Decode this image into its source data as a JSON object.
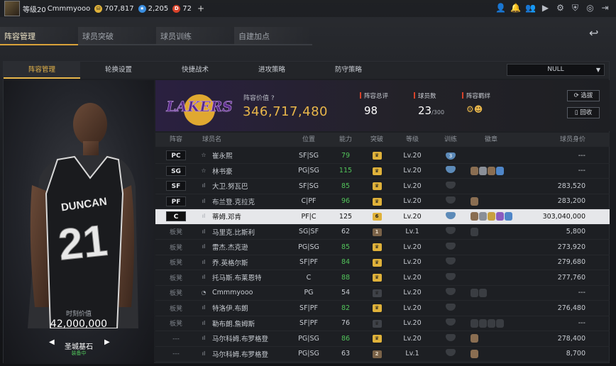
{
  "topbar": {
    "level": "等级20",
    "username": "Cmmmyooo",
    "gold": "707,817",
    "gems": "2,205",
    "tickets": "72",
    "plus": "+"
  },
  "main_tabs": [
    {
      "label": "阵容管理",
      "active": true
    },
    {
      "label": "球员突破",
      "active": false
    },
    {
      "label": "球员训练",
      "active": false
    },
    {
      "label": "自建加点",
      "active": false
    }
  ],
  "sub_tabs": [
    {
      "label": "阵容管理",
      "active": true
    },
    {
      "label": "轮换设置",
      "active": false
    },
    {
      "label": "快捷战术",
      "active": false
    },
    {
      "label": "进攻策略",
      "active": false
    },
    {
      "label": "防守策略",
      "active": false
    }
  ],
  "dropdown": {
    "value": "NULL"
  },
  "player_card": {
    "value_label": "时刻价值",
    "value": "42,000,000",
    "name": "圣城基石",
    "sub": "装备中",
    "jersey_name": "DUNCAN",
    "jersey_number": "21"
  },
  "team": {
    "logo_text": "LAKERS",
    "value_label": "阵容价值",
    "value": "346,717,480",
    "rating_label": "阵容总评",
    "rating": "98",
    "count_label": "球员数",
    "count": "23",
    "count_max": "/300",
    "bond_label": "阵容羁绊",
    "select_button": "选拔",
    "recycle_button": "回收"
  },
  "table": {
    "headers": [
      "阵容",
      "球员名",
      "位置",
      "能力",
      "突破",
      "等级",
      "训练",
      "徽章",
      "球员身价"
    ],
    "rows": [
      {
        "pos": "PC",
        "bench": false,
        "name": "崔永熙",
        "place": "SF|SG",
        "ability": "79",
        "ability_green": true,
        "break": "gold",
        "break_num": "",
        "level": "Lv.20",
        "train": "3",
        "train_blue": true,
        "badges": [],
        "value": "---",
        "selected": false
      },
      {
        "pos": "SG",
        "bench": false,
        "name": "林书豪",
        "place": "PG|SG",
        "ability": "115",
        "ability_green": true,
        "break": "gold",
        "break_num": "",
        "level": "Lv.20",
        "train": "",
        "train_blue": true,
        "badges": [
          "b1",
          "b2",
          "b1",
          "b5"
        ],
        "value": "---",
        "selected": false
      },
      {
        "pos": "SF",
        "bench": false,
        "name": "大卫.努瓦巴",
        "place": "SF|SG",
        "ability": "85",
        "ability_green": true,
        "break": "gold",
        "break_num": "",
        "level": "Lv.20",
        "train": "",
        "train_blue": false,
        "badges": [],
        "value": "283,520",
        "selected": false
      },
      {
        "pos": "PF",
        "bench": false,
        "name": "布兰登.克拉克",
        "place": "C|PF",
        "ability": "96",
        "ability_green": true,
        "break": "gold",
        "break_num": "",
        "level": "Lv.20",
        "train": "",
        "train_blue": false,
        "badges": [
          "b1"
        ],
        "value": "283,200",
        "selected": false
      },
      {
        "pos": "C",
        "bench": false,
        "name": "蒂姆.邓肯",
        "place": "PF|C",
        "ability": "125",
        "ability_green": false,
        "break": "gold",
        "break_num": "6",
        "level": "Lv.20",
        "train": "",
        "train_blue": true,
        "badges": [
          "b1",
          "b2",
          "b3",
          "b4",
          "b5"
        ],
        "value": "303,040,000",
        "selected": true
      },
      {
        "pos": "板凳",
        "bench": true,
        "name": "马里克.比斯利",
        "place": "SG|SF",
        "ability": "62",
        "ability_green": false,
        "break": "brown",
        "break_num": "1",
        "level": "Lv.1",
        "train": "",
        "train_blue": false,
        "badges": [
          "b0"
        ],
        "value": "5,800",
        "selected": false
      },
      {
        "pos": "板凳",
        "bench": true,
        "name": "雷杰.杰克逊",
        "place": "PG|SG",
        "ability": "85",
        "ability_green": true,
        "break": "gold",
        "break_num": "",
        "level": "Lv.20",
        "train": "",
        "train_blue": false,
        "badges": [],
        "value": "273,920",
        "selected": false
      },
      {
        "pos": "板凳",
        "bench": true,
        "name": "乔.英格尔斯",
        "place": "SF|PF",
        "ability": "84",
        "ability_green": true,
        "break": "gold",
        "break_num": "",
        "level": "Lv.20",
        "train": "",
        "train_blue": false,
        "badges": [],
        "value": "279,680",
        "selected": false
      },
      {
        "pos": "板凳",
        "bench": true,
        "name": "托马斯.布莱恩特",
        "place": "C",
        "ability": "88",
        "ability_green": true,
        "break": "gold",
        "break_num": "",
        "level": "Lv.20",
        "train": "",
        "train_blue": false,
        "badges": [],
        "value": "277,760",
        "selected": false
      },
      {
        "pos": "板凳",
        "bench": true,
        "name": "Cmmmyooo",
        "place": "PG",
        "ability": "54",
        "ability_green": false,
        "break": "gray",
        "break_num": "",
        "level": "Lv.20",
        "train": "",
        "train_blue": false,
        "badges": [
          "b0",
          "b0"
        ],
        "value": "---",
        "selected": false
      },
      {
        "pos": "板凳",
        "bench": true,
        "name": "特洛伊.布朗",
        "place": "SF|PF",
        "ability": "82",
        "ability_green": true,
        "break": "gold",
        "break_num": "",
        "level": "Lv.20",
        "train": "",
        "train_blue": false,
        "badges": [],
        "value": "276,480",
        "selected": false
      },
      {
        "pos": "板凳",
        "bench": true,
        "name": "勒布朗.詹姆斯",
        "place": "SF|PF",
        "ability": "76",
        "ability_green": false,
        "break": "gray",
        "break_num": "",
        "level": "Lv.20",
        "train": "",
        "train_blue": false,
        "badges": [
          "b0",
          "b0",
          "b0",
          "b0"
        ],
        "value": "---",
        "selected": false
      },
      {
        "pos": "---",
        "bench": true,
        "name": "马尔科姆.布罗格登",
        "place": "PG|SG",
        "ability": "86",
        "ability_green": true,
        "break": "gold",
        "break_num": "",
        "level": "Lv.20",
        "train": "",
        "train_blue": false,
        "badges": [
          "b1"
        ],
        "value": "278,400",
        "selected": false
      },
      {
        "pos": "---",
        "bench": true,
        "name": "马尔科姆.布罗格登",
        "place": "PG|SG",
        "ability": "63",
        "ability_green": false,
        "break": "brown",
        "break_num": "2",
        "level": "Lv.1",
        "train": "",
        "train_blue": false,
        "badges": [
          "b1"
        ],
        "value": "8,700",
        "selected": false
      }
    ]
  }
}
